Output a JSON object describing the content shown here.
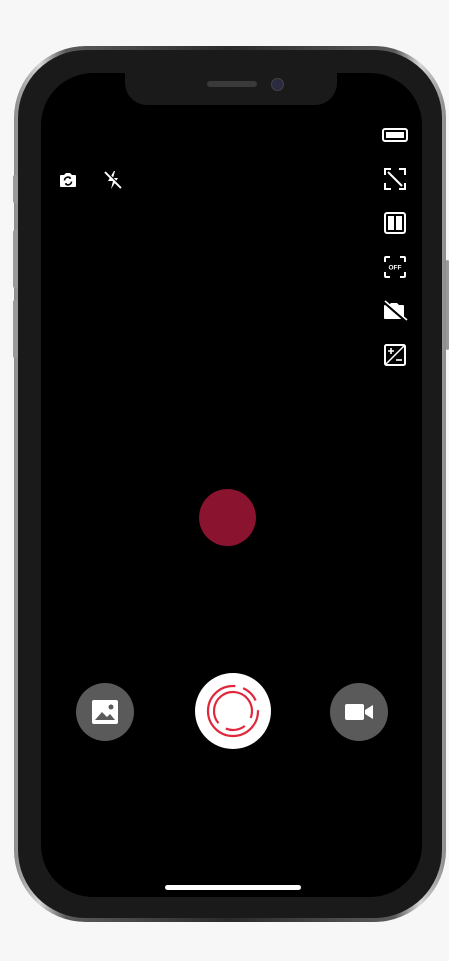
{
  "device": {
    "model_style": "iphone-x"
  },
  "camera": {
    "top_left_icons": [
      "camera-switch-icon",
      "flash-off-icon"
    ],
    "right_column_icons": [
      "aspect-ratio-icon",
      "crop-icon",
      "split-view-icon",
      "focus-off-icon",
      "hdr-off-icon",
      "exposure-icon"
    ],
    "focus_badge_text": "OFF",
    "record_indicator_color": "#8a1430",
    "bottom_controls": [
      "gallery-button",
      "shutter-button",
      "video-mode-button"
    ],
    "accent_color": "#e0283c"
  }
}
